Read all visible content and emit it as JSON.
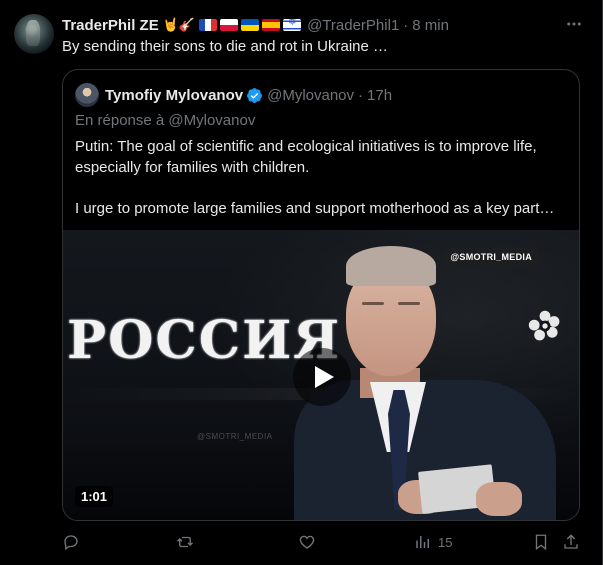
{
  "author": {
    "name": "TraderPhil ZE",
    "emoji": "🤘🎸",
    "handle": "@TraderPhil1",
    "separator": "·",
    "time": "8 min"
  },
  "tweet": {
    "text": "By sending their sons to die and rot in Ukraine …"
  },
  "quote": {
    "name": "Tymofiy Mylovanov",
    "handle": "@Mylovanov",
    "separator": "·",
    "time": "17h",
    "reply_prefix": "En réponse à",
    "reply_to": "@Mylovanov",
    "paragraph1": "Putin: The goal of scientific and ecological initiatives is to improve life, especially for families with children.",
    "paragraph2": "I urge to promote large families and support motherhood as a key part…",
    "media": {
      "watermark": "@SMOTRI_MEDIA",
      "watermark_faint": "@SMOTRI_MEDIA",
      "banner_text": "РОССИЯ",
      "duration": "1:01"
    }
  },
  "actions": {
    "views_count": "15"
  },
  "colors": {
    "background": "#000000",
    "text": "#e7e9ea",
    "muted": "#71767b",
    "border": "#2f3336",
    "verified": "#1d9bf0"
  }
}
